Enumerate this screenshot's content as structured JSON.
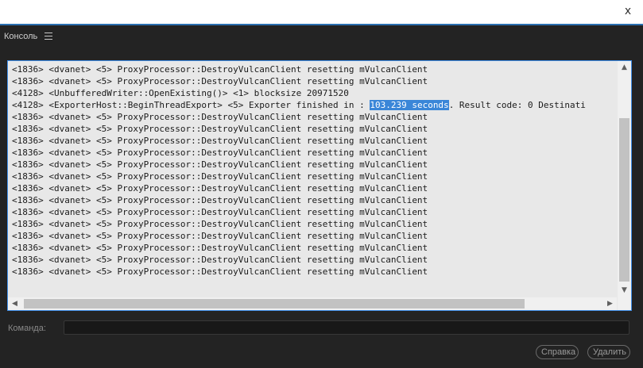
{
  "window": {
    "close_label": "x"
  },
  "panel": {
    "title": "Консоль"
  },
  "log": {
    "lines": [
      {
        "text": "<1836> <dvanet> <5> ProxyProcessor::DestroyVulcanClient resetting mVulcanClient"
      },
      {
        "text": "<1836> <dvanet> <5> ProxyProcessor::DestroyVulcanClient resetting mVulcanClient"
      },
      {
        "text": "<4128> <UnbufferedWriter::OpenExisting()> <1> blocksize 20971520"
      },
      {
        "before": "<4128> <ExporterHost::BeginThreadExport> <5> Exporter finished in : ",
        "highlight": "103.239 seconds",
        "after": ". Result code: 0 Destinati"
      },
      {
        "text": "<1836> <dvanet> <5> ProxyProcessor::DestroyVulcanClient resetting mVulcanClient"
      },
      {
        "text": "<1836> <dvanet> <5> ProxyProcessor::DestroyVulcanClient resetting mVulcanClient"
      },
      {
        "text": "<1836> <dvanet> <5> ProxyProcessor::DestroyVulcanClient resetting mVulcanClient"
      },
      {
        "text": "<1836> <dvanet> <5> ProxyProcessor::DestroyVulcanClient resetting mVulcanClient"
      },
      {
        "text": "<1836> <dvanet> <5> ProxyProcessor::DestroyVulcanClient resetting mVulcanClient"
      },
      {
        "text": "<1836> <dvanet> <5> ProxyProcessor::DestroyVulcanClient resetting mVulcanClient"
      },
      {
        "text": "<1836> <dvanet> <5> ProxyProcessor::DestroyVulcanClient resetting mVulcanClient"
      },
      {
        "text": "<1836> <dvanet> <5> ProxyProcessor::DestroyVulcanClient resetting mVulcanClient"
      },
      {
        "text": "<1836> <dvanet> <5> ProxyProcessor::DestroyVulcanClient resetting mVulcanClient"
      },
      {
        "text": "<1836> <dvanet> <5> ProxyProcessor::DestroyVulcanClient resetting mVulcanClient"
      },
      {
        "text": "<1836> <dvanet> <5> ProxyProcessor::DestroyVulcanClient resetting mVulcanClient"
      },
      {
        "text": "<1836> <dvanet> <5> ProxyProcessor::DestroyVulcanClient resetting mVulcanClient"
      },
      {
        "text": "<1836> <dvanet> <5> ProxyProcessor::DestroyVulcanClient resetting mVulcanClient"
      },
      {
        "text": "<1836> <dvanet> <5> ProxyProcessor::DestroyVulcanClient resetting mVulcanClient"
      }
    ],
    "highlight_color": "#3a86d8",
    "background_color": "#e8e8e8"
  },
  "command": {
    "label": "Команда:",
    "value": ""
  },
  "buttons": {
    "help_label": "Справка",
    "delete_label": "Удалить"
  },
  "colors": {
    "accent": "#3f8ee8",
    "panel_bg": "#232323"
  },
  "icons": {
    "panel_menu": "hamburger-menu-icon",
    "close": "close-icon",
    "scroll_up": "triangle-up-icon",
    "scroll_down": "triangle-down-icon",
    "scroll_left": "triangle-left-icon",
    "scroll_right": "triangle-right-icon"
  }
}
